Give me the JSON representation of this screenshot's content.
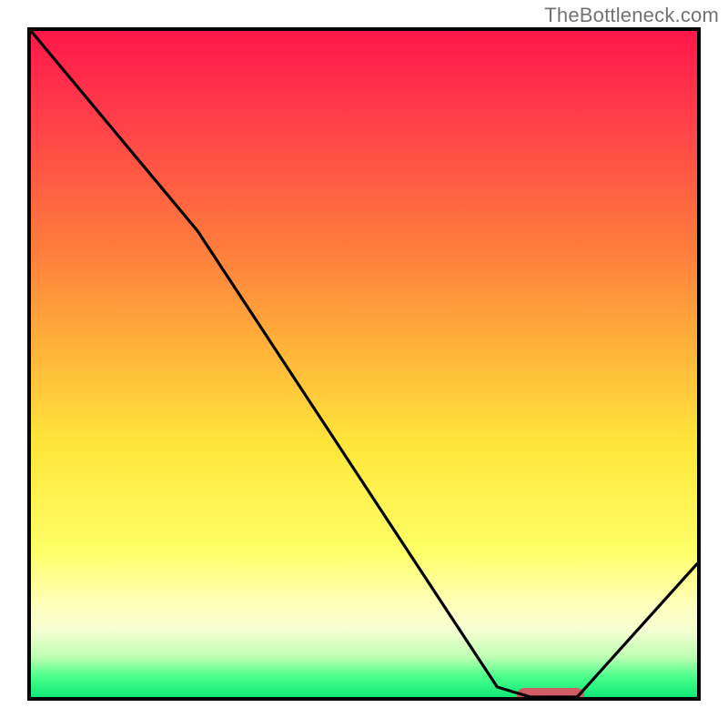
{
  "watermark": "TheBottleneck.com",
  "chart_data": {
    "type": "line",
    "title": "",
    "xlabel": "",
    "ylabel": "",
    "xlim": [
      0,
      100
    ],
    "ylim": [
      0,
      100
    ],
    "x": [
      0,
      20,
      25,
      70,
      75,
      82,
      100
    ],
    "values": [
      100,
      76,
      70,
      1.5,
      0,
      0,
      20
    ],
    "marker": {
      "x_start": 73,
      "x_end": 83,
      "y": 0
    },
    "gradient_note": "vertical color gradient red→orange→yellow→pale→green"
  },
  "colors": {
    "frame": "#000000",
    "curve": "#000000",
    "marker": "#cf5d63",
    "watermark": "#737373"
  }
}
